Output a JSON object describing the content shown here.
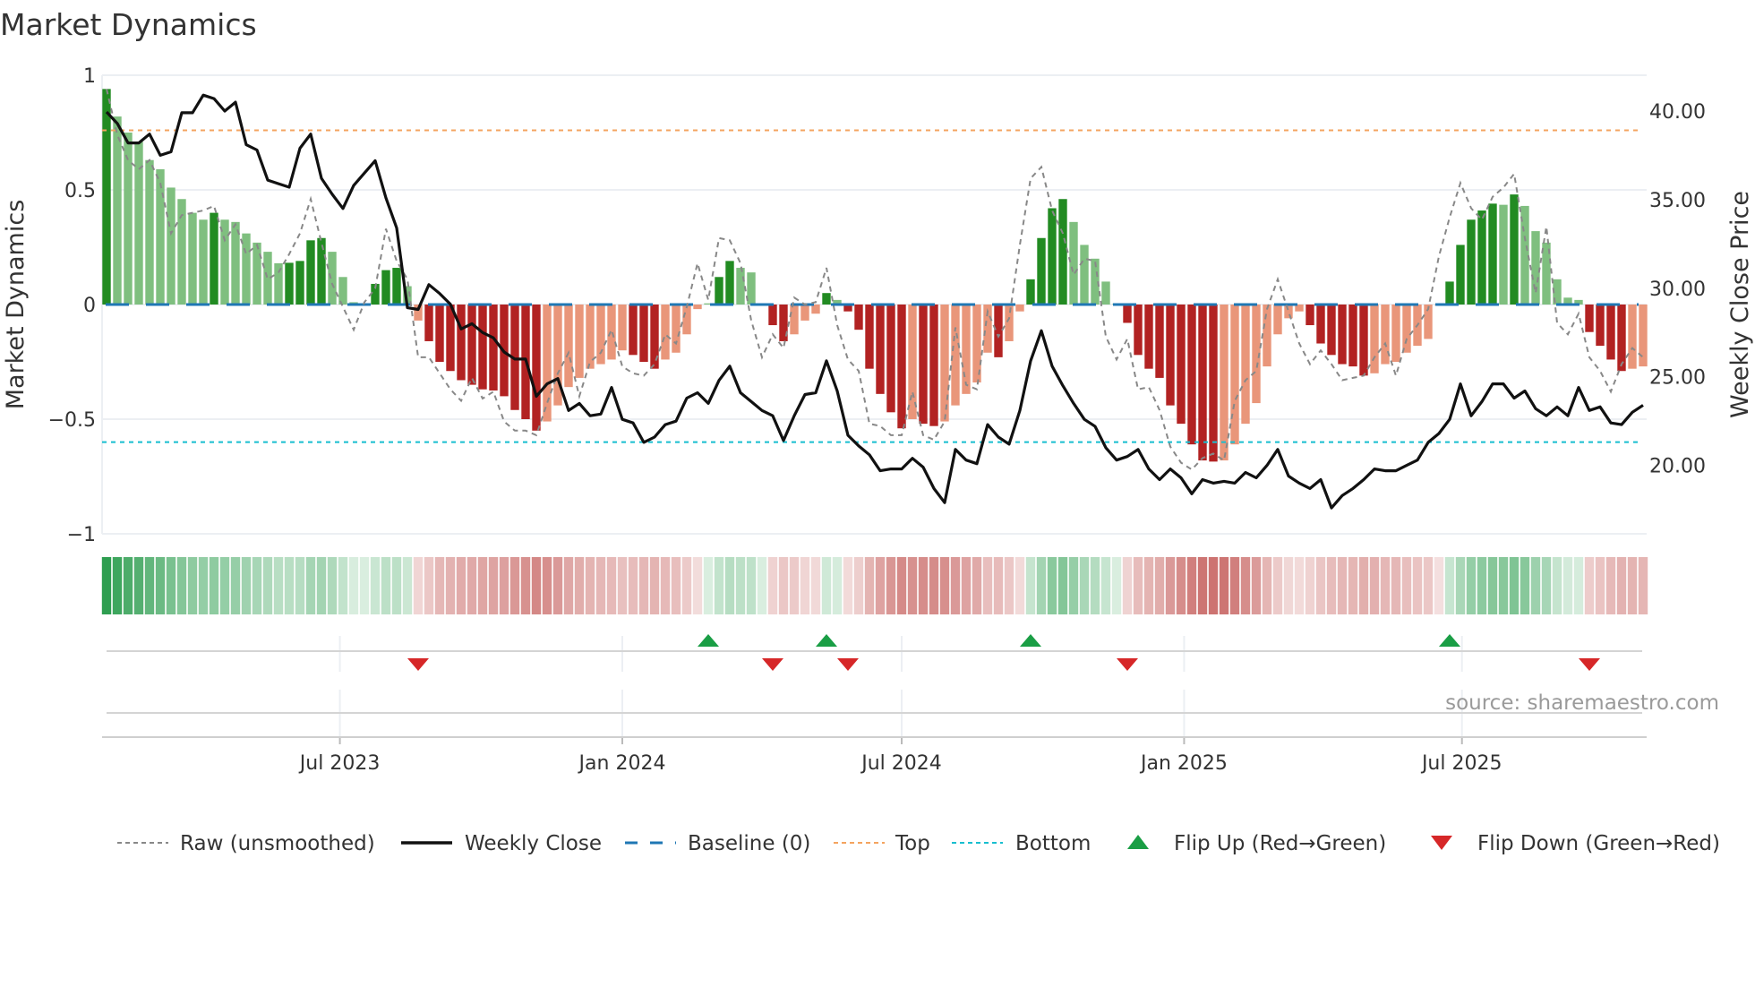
{
  "chart_data": {
    "type": "bar",
    "title": "Market Dynamics",
    "ylabel": "Market Dynamics",
    "y2label": "Weekly Close Price",
    "ylim": [
      -1,
      1
    ],
    "y2lim": [
      16.14,
      42.02
    ],
    "yticks": [
      {
        "v": 1,
        "label": "1"
      },
      {
        "v": 0.5,
        "label": "0.5"
      },
      {
        "v": 0,
        "label": "0"
      },
      {
        "v": -0.5,
        "label": "−0.5"
      },
      {
        "v": -1,
        "label": "−1"
      }
    ],
    "y2ticks": [
      {
        "v": 40,
        "label": "40.00"
      },
      {
        "v": 35,
        "label": "35.00"
      },
      {
        "v": 30,
        "label": "30.00"
      },
      {
        "v": 25,
        "label": "25.00"
      },
      {
        "v": 20,
        "label": "20.00"
      }
    ],
    "x_start": "2023-01-30",
    "x_step_days": 7,
    "xticks": [
      {
        "date": "2023-07-01",
        "label": "Jul 2023"
      },
      {
        "date": "2024-01-01",
        "label": "Jan 2024"
      },
      {
        "date": "2024-07-01",
        "label": "Jul 2024"
      },
      {
        "date": "2025-01-01",
        "label": "Jan 2025"
      },
      {
        "date": "2025-07-01",
        "label": "Jul 2025"
      }
    ],
    "reference_lines": {
      "baseline": 0,
      "top": 0.76,
      "bottom": -0.6
    },
    "colors": {
      "strong_up": "#228b22",
      "weak_up": "#7fbf7f",
      "strong_down": "#b22222",
      "weak_down": "#e9967a",
      "close": "#111111",
      "raw": "#888888",
      "baseline": "#1f77b4",
      "top": "#f4a460",
      "bottom": "#17becf",
      "flip_up": "#1a9e45",
      "flip_down": "#d62728",
      "heat_green": "#2e9e50",
      "heat_red": "#c0504d"
    },
    "series": [
      {
        "name": "Market Dynamics",
        "type": "bar",
        "values": [
          0.94,
          0.82,
          0.75,
          0.71,
          0.63,
          0.59,
          0.51,
          0.46,
          0.4,
          0.37,
          0.4,
          0.37,
          0.36,
          0.31,
          0.27,
          0.23,
          0.18,
          0.182,
          0.19,
          0.28,
          0.29,
          0.23,
          0.12,
          0.01,
          0.003,
          0.09,
          0.15,
          0.16,
          0.08,
          -0.07,
          -0.16,
          -0.25,
          -0.29,
          -0.33,
          -0.35,
          -0.37,
          -0.375,
          -0.4,
          -0.46,
          -0.5,
          -0.55,
          -0.51,
          -0.44,
          -0.36,
          -0.32,
          -0.28,
          -0.26,
          -0.24,
          -0.2,
          -0.22,
          -0.25,
          -0.28,
          -0.24,
          -0.21,
          -0.13,
          -0.02,
          0.005,
          0.12,
          0.19,
          0.16,
          0.14,
          0.003,
          -0.09,
          -0.16,
          -0.13,
          -0.07,
          -0.04,
          0.05,
          0.02,
          -0.03,
          -0.11,
          -0.28,
          -0.39,
          -0.47,
          -0.54,
          -0.5,
          -0.52,
          -0.53,
          -0.51,
          -0.44,
          -0.39,
          -0.34,
          -0.21,
          -0.23,
          -0.16,
          -0.03,
          0.11,
          0.29,
          0.42,
          0.46,
          0.36,
          0.26,
          0.2,
          0.1,
          0.003,
          -0.08,
          -0.22,
          -0.28,
          -0.32,
          -0.44,
          -0.52,
          -0.61,
          -0.68,
          -0.685,
          -0.68,
          -0.61,
          -0.52,
          -0.43,
          -0.27,
          -0.13,
          -0.06,
          -0.03,
          -0.09,
          -0.17,
          -0.22,
          -0.26,
          -0.27,
          -0.31,
          -0.3,
          -0.26,
          -0.25,
          -0.21,
          -0.18,
          -0.15,
          -0.003,
          0.1,
          0.26,
          0.37,
          0.41,
          0.44,
          0.435,
          0.48,
          0.43,
          0.32,
          0.27,
          0.11,
          0.03,
          0.02,
          -0.12,
          -0.18,
          -0.24,
          -0.29,
          -0.28,
          -0.27
        ]
      },
      {
        "name": "Raw (unsmoothed)",
        "type": "line",
        "values": [
          0.94,
          0.74,
          0.63,
          0.59,
          0.63,
          0.53,
          0.31,
          0.39,
          0.4,
          0.41,
          0.43,
          0.28,
          0.35,
          0.22,
          0.26,
          0.11,
          0.14,
          0.22,
          0.31,
          0.46,
          0.27,
          0.09,
          -0.01,
          -0.11,
          0.01,
          0.07,
          0.33,
          0.19,
          0.11,
          -0.23,
          -0.23,
          -0.3,
          -0.37,
          -0.42,
          -0.32,
          -0.41,
          -0.38,
          -0.51,
          -0.55,
          -0.55,
          -0.57,
          -0.43,
          -0.3,
          -0.21,
          -0.4,
          -0.25,
          -0.21,
          -0.11,
          -0.27,
          -0.3,
          -0.31,
          -0.26,
          -0.13,
          -0.17,
          -0.01,
          0.18,
          0.02,
          0.29,
          0.28,
          0.18,
          -0.07,
          -0.23,
          -0.13,
          -0.19,
          0.03,
          0.0,
          0.01,
          0.16,
          -0.09,
          -0.24,
          -0.29,
          -0.52,
          -0.53,
          -0.57,
          -0.57,
          -0.38,
          -0.57,
          -0.59,
          -0.51,
          -0.1,
          -0.35,
          -0.37,
          -0.03,
          -0.14,
          -0.06,
          0.26,
          0.55,
          0.6,
          0.41,
          0.31,
          0.13,
          0.2,
          0.19,
          -0.14,
          -0.24,
          -0.15,
          -0.37,
          -0.36,
          -0.46,
          -0.62,
          -0.69,
          -0.72,
          -0.67,
          -0.65,
          -0.68,
          -0.42,
          -0.33,
          -0.29,
          -0.02,
          0.11,
          -0.03,
          -0.17,
          -0.26,
          -0.2,
          -0.26,
          -0.33,
          -0.32,
          -0.31,
          -0.23,
          -0.17,
          -0.31,
          -0.15,
          -0.09,
          -0.02,
          0.21,
          0.38,
          0.53,
          0.42,
          0.37,
          0.47,
          0.51,
          0.57,
          0.29,
          0.05,
          0.34,
          -0.08,
          -0.13,
          -0.04,
          -0.23,
          -0.29,
          -0.38,
          -0.26,
          -0.19,
          -0.23
        ]
      },
      {
        "name": "Weekly Close",
        "type": "line",
        "axis": "y2",
        "values": [
          39.95,
          39.3,
          38.2,
          38.2,
          38.7,
          37.5,
          37.7,
          39.9,
          39.9,
          40.9,
          40.7,
          40.0,
          40.5,
          38.1,
          37.8,
          36.1,
          35.9,
          35.7,
          37.9,
          38.7,
          36.2,
          35.3,
          34.5,
          35.8,
          36.5,
          37.2,
          35.1,
          33.4,
          28.9,
          28.8,
          30.2,
          29.7,
          29.1,
          27.7,
          28.0,
          27.5,
          27.2,
          26.4,
          26.0,
          26.0,
          23.9,
          24.6,
          24.9,
          23.1,
          23.5,
          22.8,
          22.9,
          24.4,
          22.6,
          22.4,
          21.3,
          21.6,
          22.3,
          22.5,
          23.8,
          24.1,
          23.5,
          24.8,
          25.6,
          24.1,
          23.6,
          23.1,
          22.8,
          21.4,
          22.8,
          24.0,
          24.1,
          25.9,
          24.2,
          21.7,
          21.1,
          20.6,
          19.7,
          19.8,
          19.8,
          20.4,
          19.9,
          18.7,
          17.9,
          20.9,
          20.3,
          20.1,
          22.3,
          21.6,
          21.2,
          23.1,
          25.9,
          27.6,
          25.6,
          24.5,
          23.5,
          22.6,
          22.2,
          21.0,
          20.3,
          20.5,
          20.9,
          19.8,
          19.2,
          19.8,
          19.3,
          18.4,
          19.2,
          19.0,
          19.1,
          19.0,
          19.6,
          19.3,
          20.0,
          20.9,
          19.4,
          19.0,
          18.7,
          19.2,
          17.6,
          18.3,
          18.7,
          19.2,
          19.8,
          19.7,
          19.7,
          20.0,
          20.3,
          21.3,
          21.8,
          22.6,
          24.6,
          22.8,
          23.6,
          24.6,
          24.6,
          23.8,
          24.2,
          23.2,
          22.8,
          23.3,
          22.8,
          24.4,
          23.1,
          23.3,
          22.4,
          22.3,
          23.0,
          23.4
        ]
      }
    ],
    "flips": {
      "up": [
        "2024-02-26",
        "2024-05-13",
        "2024-09-23",
        "2025-06-23"
      ],
      "down": [
        "2023-08-21",
        "2024-04-08",
        "2024-05-27",
        "2024-11-25",
        "2025-09-22"
      ]
    },
    "legend": {
      "placement": "bottom",
      "items": [
        {
          "key": "raw",
          "label": "Raw (unsmoothed)"
        },
        {
          "key": "close",
          "label": "Weekly Close"
        },
        {
          "key": "baseline",
          "label": "Baseline (0)"
        },
        {
          "key": "top",
          "label": "Top"
        },
        {
          "key": "bottom",
          "label": "Bottom"
        },
        {
          "key": "flip_up",
          "label": "Flip Up (Red→Green)"
        },
        {
          "key": "flip_down",
          "label": "Flip Down (Green→Red)"
        }
      ]
    },
    "source": "source: sharemaestro.com"
  }
}
